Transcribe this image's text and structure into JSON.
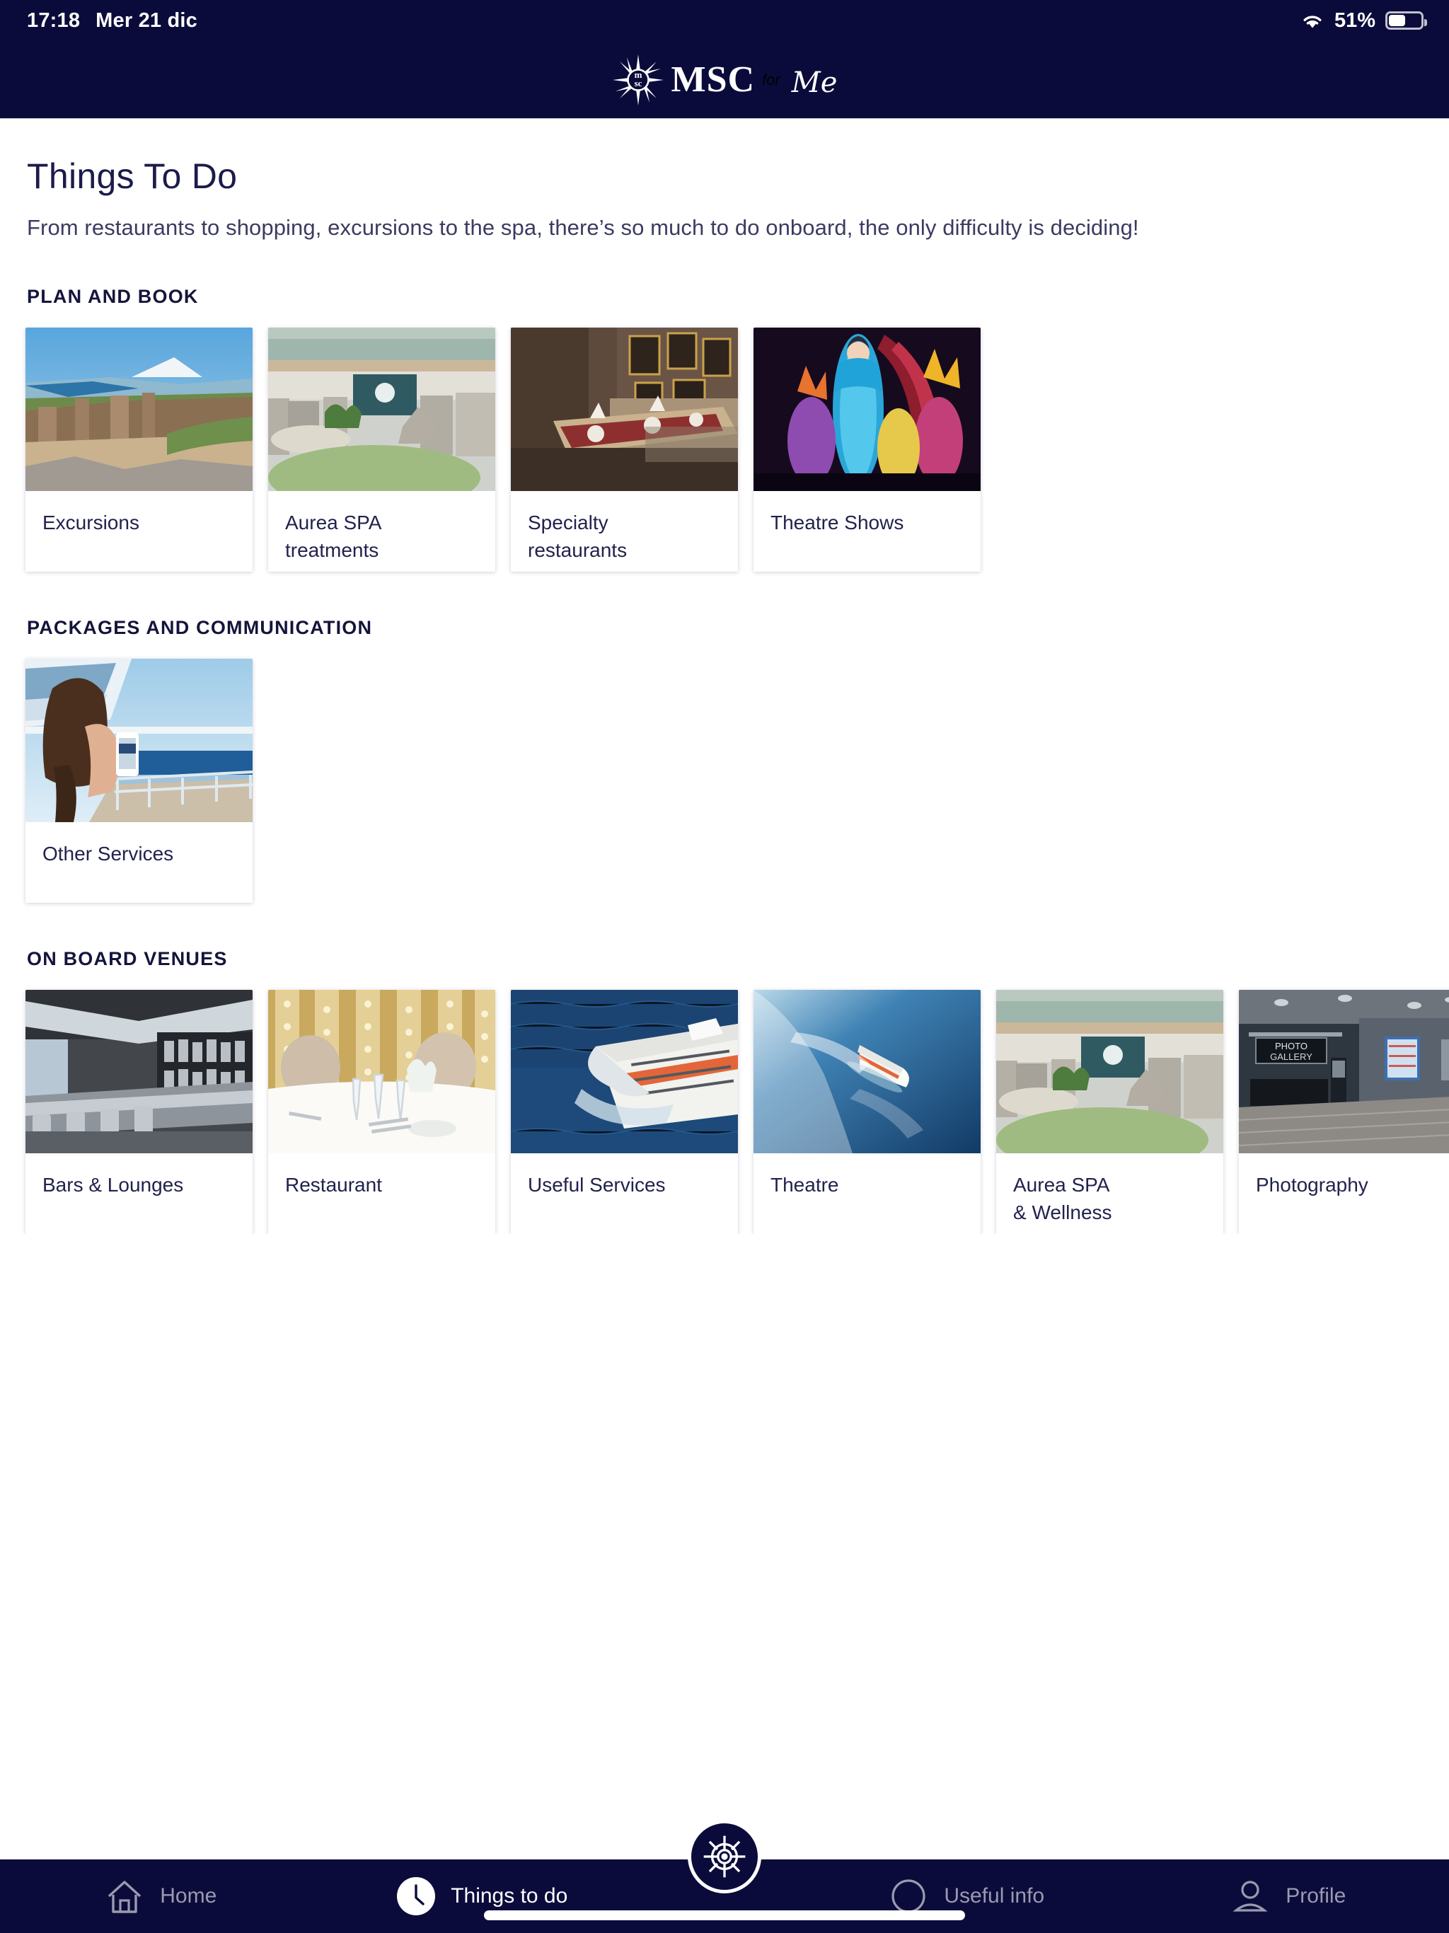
{
  "status_bar": {
    "time": "17:18",
    "date": "Mer 21 dic",
    "battery_percent": "51%",
    "wifi_icon": "wifi-icon",
    "battery_icon": "battery-icon"
  },
  "header": {
    "brand_main": "MSC",
    "brand_for": "for",
    "brand_me": "Me",
    "logo_icon": "msc-compass-star-logo"
  },
  "page": {
    "title": "Things To Do",
    "subtitle": "From restaurants to shopping, excursions to the spa, there’s so much to do onboard, the only difficulty is deciding!"
  },
  "sections": [
    {
      "id": "plan-and-book",
      "title": "PLAN AND BOOK",
      "cards": [
        {
          "label": "Excursions",
          "image": "excursion-ruins-sea-photo"
        },
        {
          "label": "Aurea SPA\ntreatments",
          "image": "spa-interior-photo"
        },
        {
          "label": "Specialty\nrestaurants",
          "image": "specialty-restaurant-table-photo"
        },
        {
          "label": "Theatre Shows",
          "image": "theatre-performers-photo"
        }
      ]
    },
    {
      "id": "packages-and-communication",
      "title": "PACKAGES AND COMMUNICATION",
      "cards": [
        {
          "label": "Other Services",
          "image": "woman-on-deck-with-phone-photo"
        }
      ]
    },
    {
      "id": "on-board-venues",
      "title": "ON BOARD VENUES",
      "cards": [
        {
          "label": "Bars & Lounges",
          "image": "bar-lounge-photo"
        },
        {
          "label": "Restaurant",
          "image": "restaurant-table-photo"
        },
        {
          "label": "Useful Services",
          "image": "cruise-ship-aerial-photo"
        },
        {
          "label": "Theatre",
          "image": "cruise-ship-at-sea-photo"
        },
        {
          "label": "Aurea SPA\n& Wellness",
          "image": "spa-wellness-interior-photo"
        },
        {
          "label": "Photography",
          "image": "photo-gallery-corridor-photo"
        }
      ]
    }
  ],
  "tabbar": {
    "items": [
      {
        "label": "Home",
        "icon": "home-icon",
        "active": false
      },
      {
        "label": "Things to do",
        "icon": "clock-icon",
        "active": true
      },
      {
        "label": "",
        "icon": "ship-wheel-icon",
        "active": false
      },
      {
        "label": "Useful info",
        "icon": "compass-icon",
        "active": false
      },
      {
        "label": "Profile",
        "icon": "person-icon",
        "active": false
      }
    ]
  },
  "colors": {
    "brand_navy": "#0b0b3b",
    "text_navy": "#22224e",
    "inactive_gray": "#9a9ab0",
    "page_bg": "#ffffff"
  }
}
